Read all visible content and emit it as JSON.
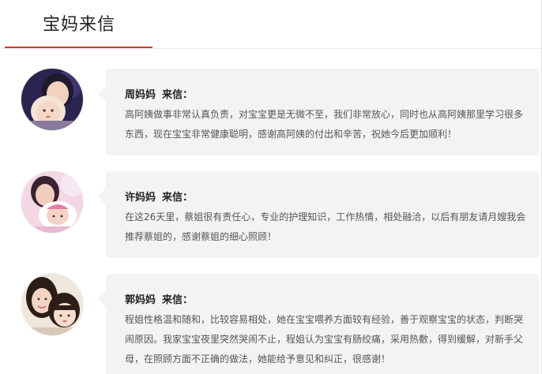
{
  "header": {
    "title": "宝妈来信"
  },
  "letters": [
    {
      "name": "周妈妈",
      "suffix": "来信：",
      "text": "高阿姨做事非常认真负责，对宝宝更是无微不至，我们非常放心，同时也从高阿姨那里学习很多东西，现在宝宝非常健康聪明，感谢高阿姨的付出和辛苦，祝她今后更加顺利！"
    },
    {
      "name": "许妈妈",
      "suffix": "来信：",
      "text": "在这26天里，蔡姐很有责任心，专业的护理知识，工作热情，相处融洽，以后有朋友请月嫂我会推荐蔡姐的，感谢蔡姐的细心照顾！"
    },
    {
      "name": "郭妈妈",
      "suffix": "来信：",
      "text": "程姐性格温和随和，比较容易相处，她在宝宝喂养方面较有经验，善于观察宝宝的状态，判断哭闹原因。我家宝宝夜里突然哭闹不止，程姐认为宝宝有肠绞痛，采用热敷，得到缓解，对新手父母，在照顾方面不正确的做法，她能给予意见和纠正，很感谢！"
    }
  ]
}
